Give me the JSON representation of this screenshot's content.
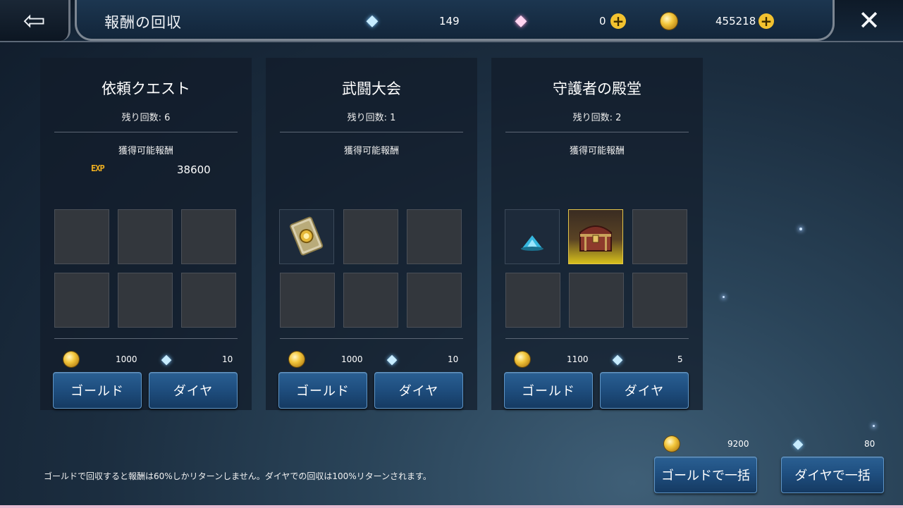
{
  "header": {
    "title": "報酬の回収",
    "back_icon": "back-arrow-icon",
    "close_icon": "close-icon",
    "currencies": [
      {
        "icon": "diamond-icon",
        "value": "149"
      },
      {
        "icon": "premium-diamond-icon",
        "value": "0"
      },
      {
        "icon": "gold-coin-icon",
        "value": "455218"
      }
    ]
  },
  "panels": [
    {
      "title": "依頼クエスト",
      "remaining": "残り回数: 6",
      "reward_label": "獲得可能報酬",
      "exp_icon_text": "EXP",
      "exp_value": "38600",
      "slots": [
        "empty",
        "empty",
        "empty",
        "empty",
        "empty",
        "empty"
      ],
      "gold_cost": "1000",
      "diamond_cost": "10",
      "gold_button": "ゴールド",
      "diamond_button": "ダイヤ"
    },
    {
      "title": "武闘大会",
      "remaining": "残り回数: 1",
      "reward_label": "獲得可能報酬",
      "slots": [
        "scroll-item",
        "empty",
        "empty",
        "empty",
        "empty",
        "empty"
      ],
      "gold_cost": "1000",
      "diamond_cost": "10",
      "gold_button": "ゴールド",
      "diamond_button": "ダイヤ"
    },
    {
      "title": "守護者の殿堂",
      "remaining": "残り回数: 2",
      "reward_label": "獲得可能報酬",
      "slots": [
        "blue-crystal-item",
        "treasure-chest-item",
        "empty",
        "empty",
        "empty",
        "empty"
      ],
      "gold_cost": "1100",
      "diamond_cost": "5",
      "gold_button": "ゴールド",
      "diamond_button": "ダイヤ"
    }
  ],
  "bulk": {
    "gold_cost": "9200",
    "diamond_cost": "80",
    "gold_button": "ゴールドで一括",
    "diamond_button": "ダイヤで一括"
  },
  "note": "ゴールドで回収すると報酬は60%しかリターンしません。ダイヤでの回収は100%リターンされます。",
  "colors": {
    "button_blue": "#1f4f80",
    "gold": "#f3c73d",
    "panel_bg": "#121c2a"
  }
}
